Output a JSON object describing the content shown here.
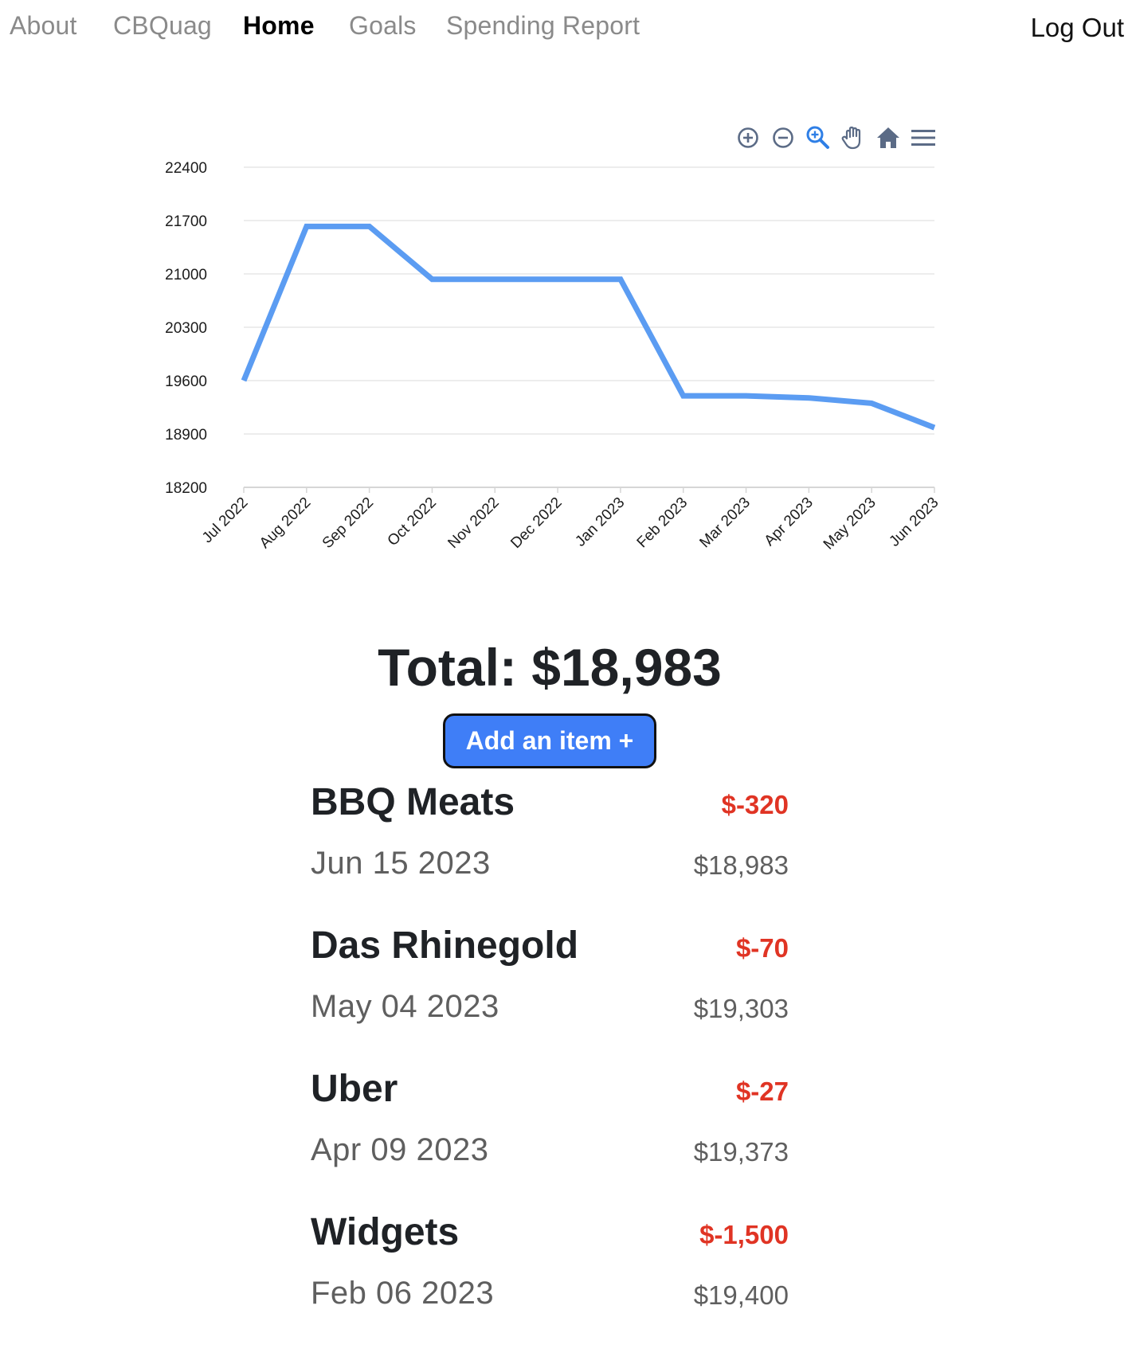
{
  "nav": {
    "links": [
      {
        "label": "About"
      },
      {
        "label": "CBQuag"
      },
      {
        "label": "Home"
      },
      {
        "label": "Goals"
      },
      {
        "label": "Spending Report"
      }
    ],
    "active": "Home",
    "logout_label": "Log Out"
  },
  "toolbar": {
    "icons": [
      "zoom-in-icon",
      "zoom-out-icon",
      "selection-zoom-icon",
      "pan-hand-icon",
      "reset-home-icon",
      "menu-icon"
    ]
  },
  "chart_data": {
    "type": "line",
    "title": "",
    "xlabel": "",
    "ylabel": "",
    "categories": [
      "Jul 2022",
      "Aug 2022",
      "Sep 2022",
      "Oct 2022",
      "Nov 2022",
      "Dec 2022",
      "Jan 2023",
      "Feb 2023",
      "Mar 2023",
      "Apr 2023",
      "May 2023",
      "Jun 2023"
    ],
    "series": [
      {
        "values": [
          19600,
          21623,
          21623,
          20930,
          20930,
          20930,
          20930,
          19400,
          19400,
          19373,
          19303,
          18983
        ]
      }
    ],
    "yticks": [
      18200,
      18900,
      19600,
      20300,
      21000,
      21700,
      22400
    ],
    "ylim": [
      18200,
      22400
    ],
    "grid": true,
    "line_color": "#5b9cf2"
  },
  "total": {
    "label": "Total: $18,983"
  },
  "add_button": {
    "label": "Add an item +"
  },
  "items": [
    {
      "name": "BBQ Meats",
      "amount": "$-320",
      "date": "Jun 15 2023",
      "balance": "$18,983"
    },
    {
      "name": "Das Rhinegold",
      "amount": "$-70",
      "date": "May 04 2023",
      "balance": "$19,303"
    },
    {
      "name": "Uber",
      "amount": "$-27",
      "date": "Apr 09 2023",
      "balance": "$19,373"
    },
    {
      "name": "Widgets",
      "amount": "$-1,500",
      "date": "Feb 06 2023",
      "balance": "$19,400"
    }
  ],
  "colors": {
    "accent": "#3f7ef7",
    "negative": "#e03424",
    "muted": "#5f5f5f",
    "nav_inactive": "#8a8a8a"
  }
}
